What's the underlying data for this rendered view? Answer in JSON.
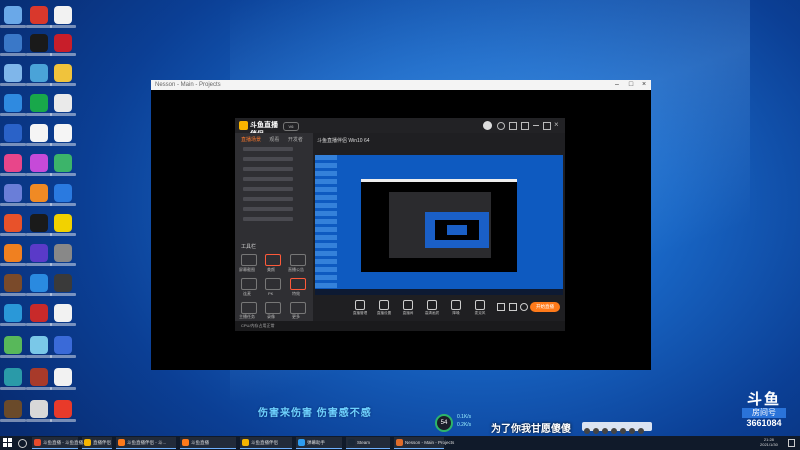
{
  "window": {
    "title": "Nesson - Main - Projects"
  },
  "app": {
    "logo_text": "斗鱼直播伴侣",
    "version": "V6",
    "sidebar_tabs": [
      "直播场景",
      "观看",
      "开发者"
    ],
    "tools_header": "工具栏",
    "tools": [
      "屏幕截图",
      "美颜",
      "直播公告",
      "连麦",
      "PK",
      "特效",
      "主播任务",
      "录像",
      "更多"
    ],
    "room_title": "斗鱼直播伴侣 Win10 64",
    "controls": [
      "直播管理",
      "直播设置",
      "直播间",
      "高清画质",
      "降噪",
      "麦克风"
    ],
    "start_live": "开始直播",
    "status_text": "CPU/内存占用正常"
  },
  "overlay": {
    "caption": "伤害来伤害 伤害感不感",
    "caption2": "为了你我甘愿傻傻",
    "gauge": "54",
    "speed_up": "0.1K/s",
    "speed_down": "0.2K/s"
  },
  "douyu": {
    "brand": "斗鱼",
    "room_label": "房间号",
    "room_number": "3661084"
  },
  "taskbar": {
    "tasks": [
      {
        "label": "斗鱼直播 - 斗鱼直播...",
        "color": "#e84b2a"
      },
      {
        "label": "直播伴侣",
        "color": "#f5b400"
      },
      {
        "label": "斗鱼直播伴侣 - 斗...",
        "color": "#ff7a1a"
      },
      {
        "label": "斗鱼直播",
        "color": "#ff7a1a"
      },
      {
        "label": "斗鱼直播伴侣",
        "color": "#f5b400"
      },
      {
        "label": "弹幕助手",
        "color": "#2d9cf0"
      },
      {
        "label": "Steam",
        "color": "#1b2838"
      },
      {
        "label": "Nesson - Main - Projects",
        "color": "#e06c2a"
      }
    ],
    "time": "21:28",
    "date": "2021/1/30"
  }
}
